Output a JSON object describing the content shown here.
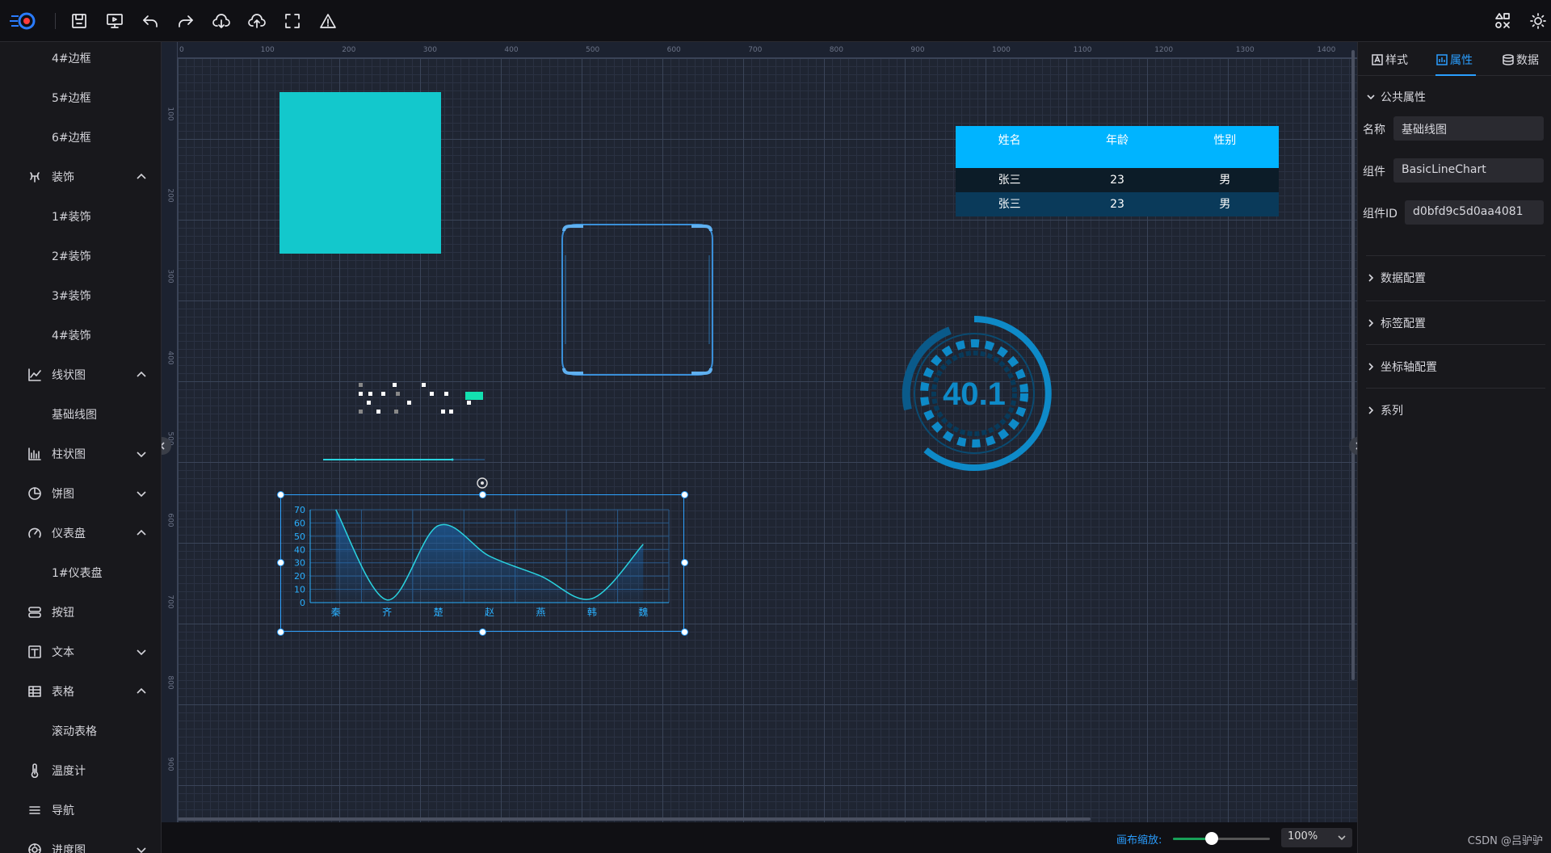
{
  "toolbar": {
    "buttons": [
      "save-icon",
      "preview-icon",
      "undo-icon",
      "redo-icon",
      "download-icon",
      "upload-icon",
      "fullscreen-icon",
      "warning-icon"
    ]
  },
  "sidebar": {
    "items": [
      {
        "label": "4#边框",
        "type": "child"
      },
      {
        "label": "5#边框",
        "type": "child"
      },
      {
        "label": "6#边框",
        "type": "child"
      },
      {
        "label": "装饰",
        "type": "group",
        "icon": "decoration-icon",
        "expanded": true
      },
      {
        "label": "1#装饰",
        "type": "child"
      },
      {
        "label": "2#装饰",
        "type": "child"
      },
      {
        "label": "3#装饰",
        "type": "child"
      },
      {
        "label": "4#装饰",
        "type": "child"
      },
      {
        "label": "线状图",
        "type": "group",
        "icon": "line-chart-icon",
        "expanded": true
      },
      {
        "label": "基础线图",
        "type": "child"
      },
      {
        "label": "柱状图",
        "type": "group",
        "icon": "bar-chart-icon",
        "expanded": false
      },
      {
        "label": "饼图",
        "type": "group",
        "icon": "pie-chart-icon",
        "expanded": false
      },
      {
        "label": "仪表盘",
        "type": "group",
        "icon": "gauge-icon",
        "expanded": true
      },
      {
        "label": "1#仪表盘",
        "type": "child"
      },
      {
        "label": "按钮",
        "type": "group",
        "icon": "button-icon"
      },
      {
        "label": "文本",
        "type": "group",
        "icon": "text-icon",
        "expanded": false
      },
      {
        "label": "表格",
        "type": "group",
        "icon": "table-icon",
        "expanded": true
      },
      {
        "label": "滚动表格",
        "type": "child"
      },
      {
        "label": "温度计",
        "type": "group",
        "icon": "thermometer-icon"
      },
      {
        "label": "导航",
        "type": "group",
        "icon": "menu-icon"
      },
      {
        "label": "进度图",
        "type": "group",
        "icon": "progress-icon",
        "expanded": false
      }
    ]
  },
  "ruler": {
    "x": [
      "0",
      "100",
      "200",
      "300",
      "400",
      "500",
      "600",
      "700",
      "800",
      "900",
      "1000",
      "1100",
      "1200",
      "1300",
      "1400"
    ],
    "y": [
      "100",
      "200",
      "300",
      "400",
      "500",
      "600",
      "700",
      "800",
      "900"
    ]
  },
  "table": {
    "headers": [
      "姓名",
      "年龄",
      "性别"
    ],
    "rows": [
      [
        "张三",
        "23",
        "男"
      ],
      [
        "张三",
        "23",
        "男"
      ]
    ],
    "header_color": "#00b4ff"
  },
  "gauge": {
    "value": "40.1",
    "color": "#0e8ac8"
  },
  "rect": {
    "color": "#13c8cc"
  },
  "chart_data": {
    "type": "line",
    "categories": [
      "秦",
      "齐",
      "楚",
      "赵",
      "燕",
      "韩",
      "魏"
    ],
    "series": [
      {
        "values": [
          70,
          2,
          58,
          35,
          20,
          3,
          44
        ]
      }
    ],
    "ylim": [
      0,
      70
    ],
    "yticks": [
      "0",
      "10",
      "20",
      "30",
      "40",
      "50",
      "60",
      "70"
    ],
    "smooth": true,
    "area_fill": true,
    "grid": true,
    "color": "#2ad4e0"
  },
  "footer": {
    "zoom_label": "画布缩放:",
    "zoom_value": "100%",
    "zoom_percent": 40
  },
  "panel": {
    "tabs": [
      "样式",
      "属性",
      "数据"
    ],
    "active_tab": "属性",
    "section_common": "公共属性",
    "name_label": "名称",
    "name_value": "基础线图",
    "component_label": "组件",
    "component_value": "BasicLineChart",
    "id_label": "组件ID",
    "id_value": "d0bfd9c5d0aa4081",
    "sections": [
      "数据配置",
      "标签配置",
      "坐标轴配置",
      "系列"
    ]
  },
  "watermark": "CSDN @吕驴驴",
  "accent": "#2a9eff"
}
